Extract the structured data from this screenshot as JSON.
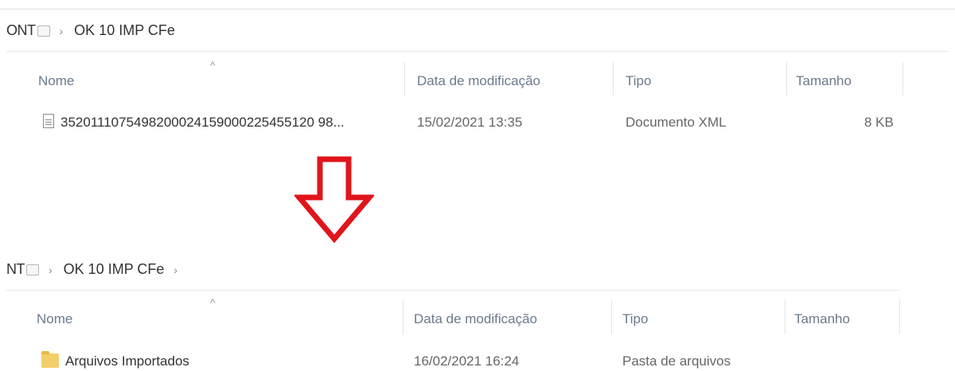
{
  "top": {
    "breadcrumb_prefix": "ONT",
    "breadcrumb_current": "OK 10 IMP CFe",
    "columns": [
      "Nome",
      "Data de modificação",
      "Tipo",
      "Tamanho"
    ],
    "file": {
      "icon": "xml-document-icon",
      "name": "3520111075498200024159000225455120 98...",
      "date": "15/02/2021 13:35",
      "type": "Documento XML",
      "size": "8 KB"
    }
  },
  "arrow": {
    "icon": "down-arrow-icon",
    "color": "#e0151b"
  },
  "bottom": {
    "breadcrumb_prefix": "NT",
    "breadcrumb_current": "OK 10 IMP CFe",
    "columns": [
      "Nome",
      "Data de modificação",
      "Tipo",
      "Tamanho"
    ],
    "folder": {
      "icon": "folder-icon",
      "name": "Arquivos Importados",
      "date": "16/02/2021 16:24",
      "type": "Pasta de arquivos",
      "size": ""
    }
  }
}
